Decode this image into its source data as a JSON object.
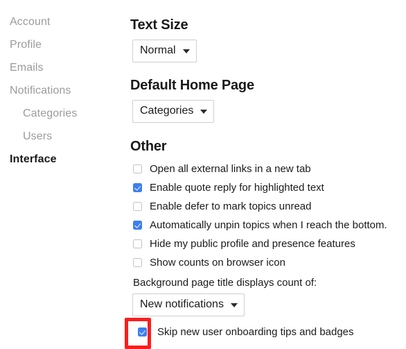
{
  "sidebar": {
    "items": [
      {
        "label": "Account",
        "sub": false,
        "active": false
      },
      {
        "label": "Profile",
        "sub": false,
        "active": false
      },
      {
        "label": "Emails",
        "sub": false,
        "active": false
      },
      {
        "label": "Notifications",
        "sub": false,
        "active": false
      },
      {
        "label": "Categories",
        "sub": true,
        "active": false
      },
      {
        "label": "Users",
        "sub": true,
        "active": false
      },
      {
        "label": "Interface",
        "sub": false,
        "active": true
      }
    ]
  },
  "main": {
    "text_size": {
      "heading": "Text Size",
      "selected": "Normal"
    },
    "default_home_page": {
      "heading": "Default Home Page",
      "selected": "Categories"
    },
    "other": {
      "heading": "Other",
      "checkboxes": [
        {
          "label": "Open all external links in a new tab",
          "checked": false
        },
        {
          "label": "Enable quote reply for highlighted text",
          "checked": true
        },
        {
          "label": "Enable defer to mark topics unread",
          "checked": false
        },
        {
          "label": "Automatically unpin topics when I reach the bottom.",
          "checked": true
        },
        {
          "label": "Hide my public profile and presence features",
          "checked": false
        },
        {
          "label": "Show counts on browser icon",
          "checked": false
        }
      ],
      "background_count_label": "Background page title displays count of:",
      "background_count_selected": "New notifications",
      "skip_onboarding": {
        "label": "Skip new user onboarding tips and badges",
        "checked": true
      }
    }
  },
  "annotation": {
    "color": "#fb1d1d"
  }
}
